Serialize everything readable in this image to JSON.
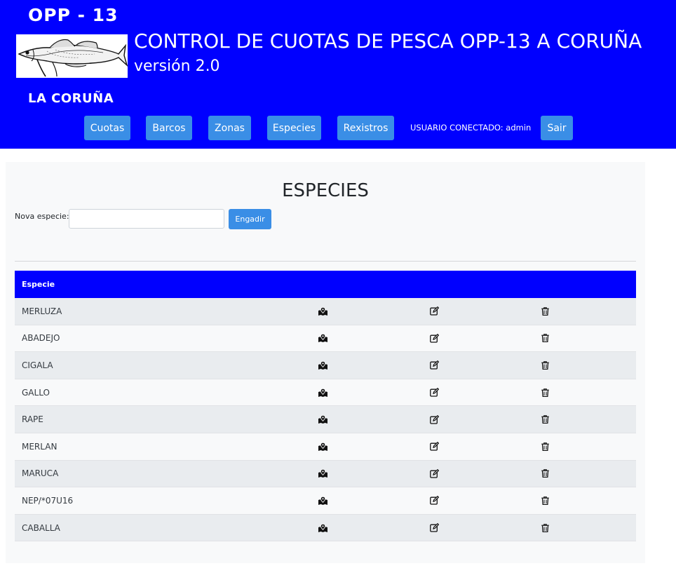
{
  "header": {
    "brand_top": "OPP - 13",
    "brand_city": "LA CORUÑA",
    "title": "CONTROL DE CUOTAS DE PESCA OPP-13 A CORUÑA",
    "version": "versión 2.0",
    "logo_icon": "fish-icon",
    "background": "#0000ff"
  },
  "nav": {
    "items": [
      {
        "label": "Cuotas"
      },
      {
        "label": "Barcos"
      },
      {
        "label": "Zonas"
      },
      {
        "label": "Especies"
      },
      {
        "label": "Rexistros"
      }
    ],
    "user_text": "USUARIO CONECTADO: admin",
    "logout_label": "Sair",
    "button_color": "#3a8ee6"
  },
  "main": {
    "title": "ESPECIES",
    "form": {
      "label": "Nova especie:",
      "input_value": "",
      "placeholder": "",
      "submit_label": "Engadir"
    },
    "table": {
      "header": "Especie",
      "header_color": "#0000ff",
      "row_icons": [
        "map-marked-icon",
        "edit-icon",
        "trash-icon"
      ],
      "rows": [
        {
          "name": "MERLUZA"
        },
        {
          "name": "ABADEJO"
        },
        {
          "name": "CIGALA"
        },
        {
          "name": "GALLO"
        },
        {
          "name": "RAPE"
        },
        {
          "name": "MERLAN"
        },
        {
          "name": "MARUCA"
        },
        {
          "name": "NEP/*07U16"
        },
        {
          "name": "CABALLA"
        }
      ]
    }
  }
}
